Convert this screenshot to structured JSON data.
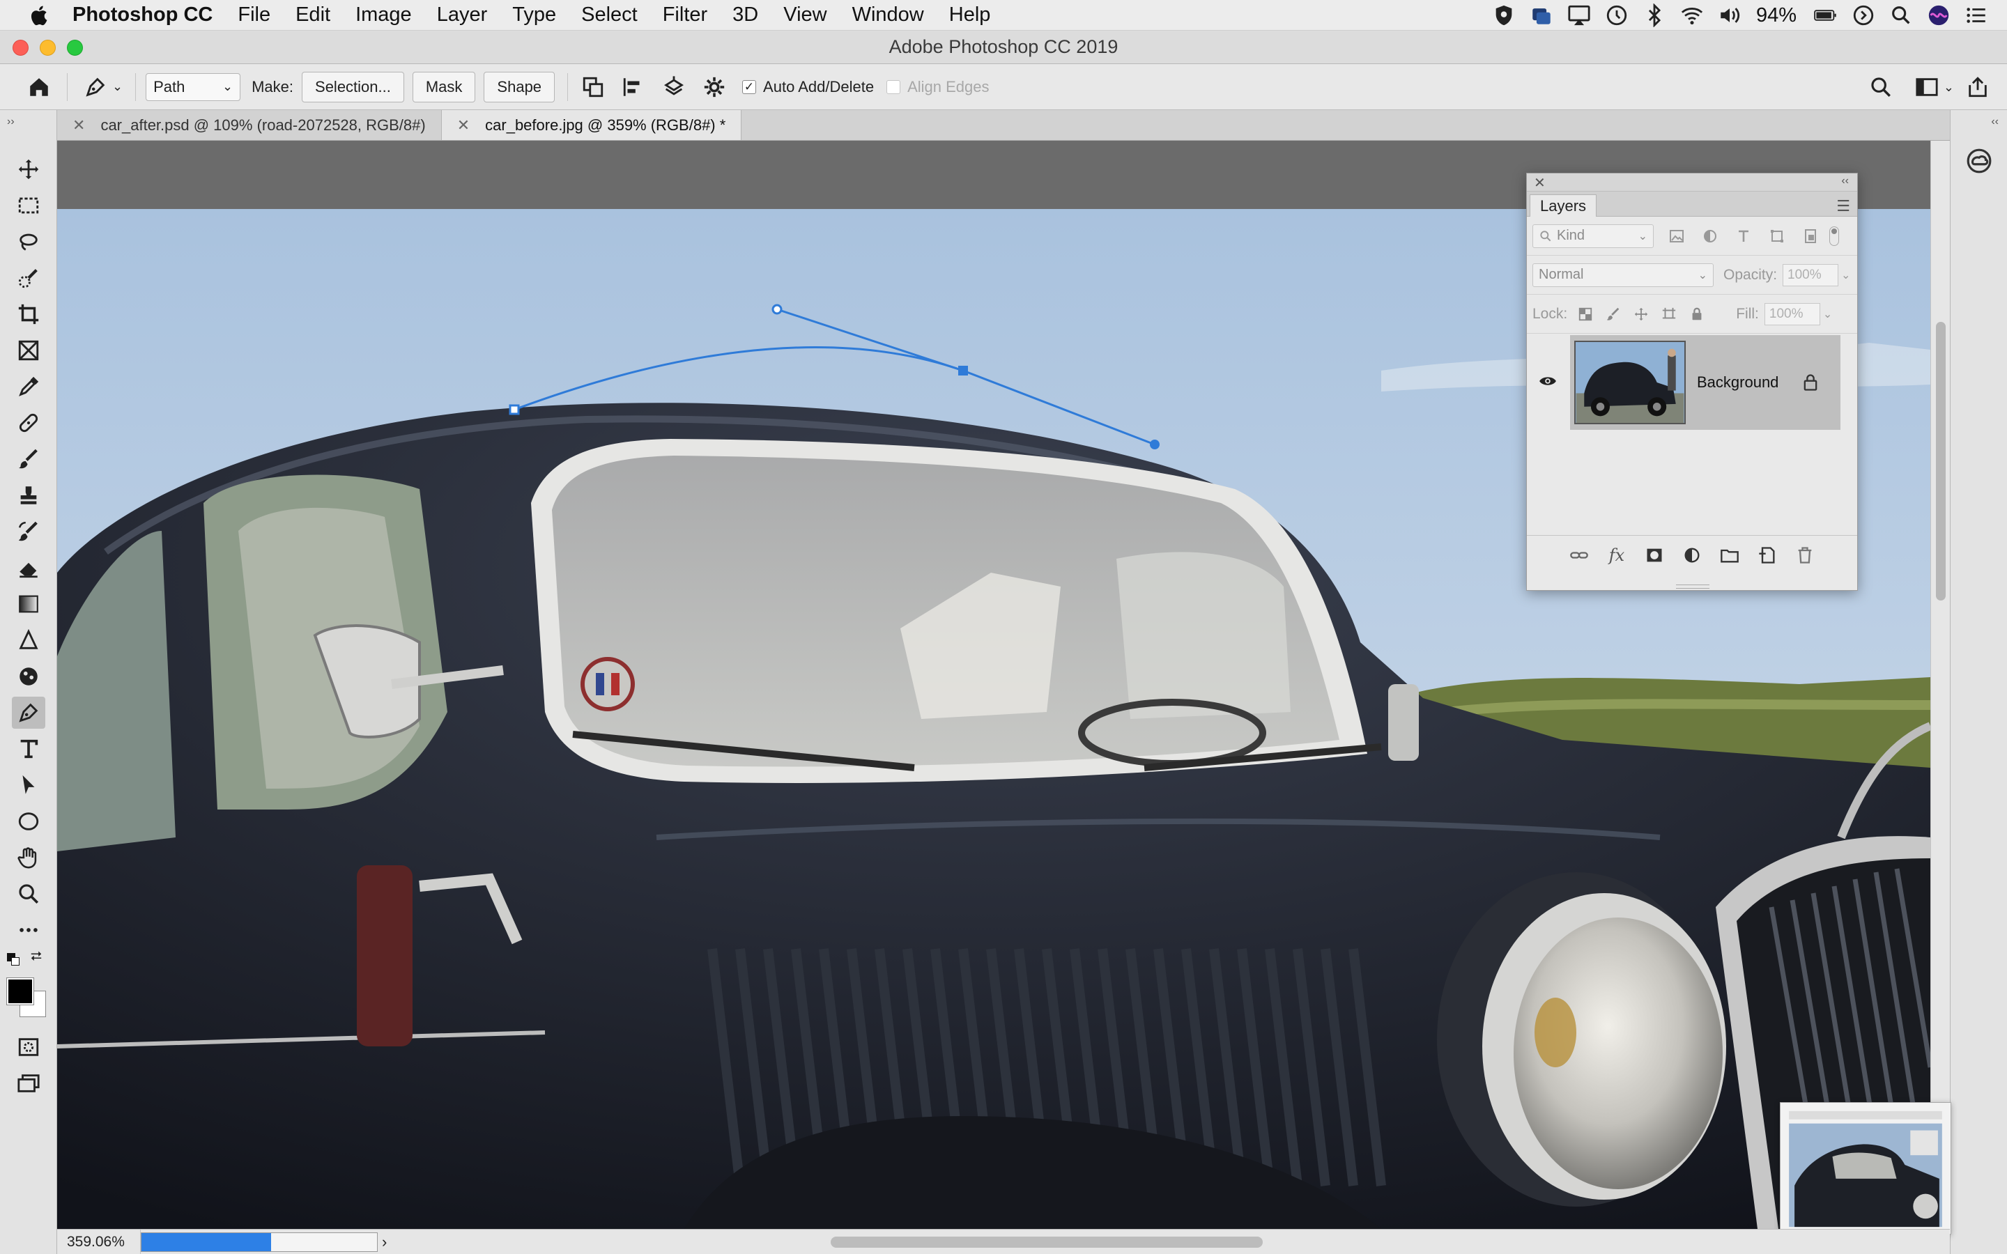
{
  "menubar": {
    "app_name": "Photoshop CC",
    "items": [
      "File",
      "Edit",
      "Image",
      "Layer",
      "Type",
      "Select",
      "Filter",
      "3D",
      "View",
      "Window",
      "Help"
    ],
    "battery": "94%"
  },
  "titlebar": {
    "title": "Adobe Photoshop CC 2019"
  },
  "options": {
    "mode_value": "Path",
    "make_label": "Make:",
    "selection_button": "Selection...",
    "mask_button": "Mask",
    "shape_button": "Shape",
    "auto_add_delete": "Auto Add/Delete",
    "auto_add_delete_checked": true,
    "align_edges": "Align Edges"
  },
  "tabs": [
    {
      "label": "car_after.psd @ 109% (road-2072528, RGB/8#)",
      "active": false
    },
    {
      "label": "car_before.jpg @ 359% (RGB/8#) *",
      "active": true
    }
  ],
  "layers_panel": {
    "tab_label": "Layers",
    "kind_label": "Kind",
    "blend_mode": "Normal",
    "opacity_label": "Opacity:",
    "opacity_value": "100%",
    "lock_label": "Lock:",
    "fill_label": "Fill:",
    "fill_value": "100%",
    "layers": [
      {
        "name": "Background",
        "visible": true,
        "locked": true
      }
    ]
  },
  "status": {
    "zoom": "359.06%",
    "progress": 0.55
  },
  "colors": {
    "path_blue": "#2f7bd8",
    "progress_blue": "#2d80e6",
    "sky_top": "#a9c2de",
    "car_black": "#1d2027"
  }
}
